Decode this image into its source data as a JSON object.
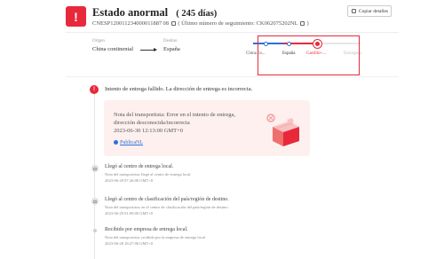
{
  "header": {
    "icon_glyph": "!",
    "title": "Estado anormal",
    "days": "( 245 días)",
    "tracking_number": "CNESP120011234000011887 08",
    "last_tracking_label": "( Último número de seguimiento: CK062075202NL",
    "last_tracking_end": ")",
    "copy_button": "Copiar detalles"
  },
  "route": {
    "origin_label": "Origen",
    "origin_value": "China continental",
    "destination_label": "Destino",
    "destination_value": "España"
  },
  "progress": {
    "steps": [
      "China co...",
      "España",
      "Castillo+...",
      "Entregado"
    ],
    "current_step_index": 2,
    "colors": {
      "done": "#2e6fd6",
      "current": "#e8293b",
      "pending": "#bbbbbb"
    }
  },
  "latest_event": {
    "alert_glyph": "!",
    "text": "Intento de entrega fallido. La dirección de entrega es incorrecta.",
    "note": "Nota del transportista: Error en el intento de entrega, dirección desconocida/incorrecta",
    "time": "2023-06-30 12:13:00 GMT+0",
    "carrier_link": "PublicaNL"
  },
  "events": [
    {
      "title": "Llegó al centro de entrega local.",
      "sub": "Nota del transportista: llegó al centro de entrega local",
      "date": "2023-06-29 07:26:00 GMT+0",
      "icon": "package-icon"
    },
    {
      "title": "Llegó al centro de clasificación del país/región de destino.",
      "sub": "Nota del transportista: en el centro de clasificación del país/región de destino",
      "date": "2023-06-29 01:09:00 GMT+0",
      "icon": "package-icon"
    },
    {
      "title": "Recibido por empresa de entrega local.",
      "sub": "Nota del transportista: recibido por la empresa de entrega local",
      "date": "2023-06-28 18:27:00 GMT+0",
      "icon": "dot-icon"
    }
  ],
  "colors": {
    "accent_red": "#e8293b",
    "accent_blue": "#2e6fd6",
    "note_bg": "#fdf0ef"
  }
}
